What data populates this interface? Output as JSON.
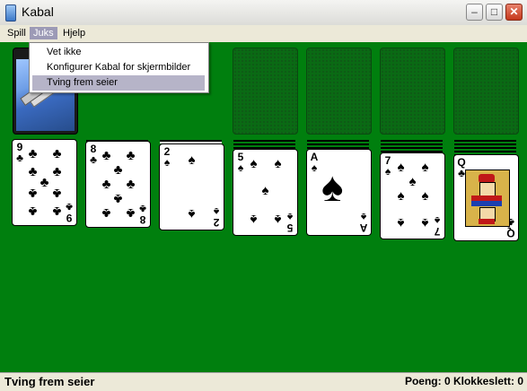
{
  "window": {
    "title": "Kabal",
    "minimize": "–",
    "maximize": "□",
    "close": "✕"
  },
  "menubar": {
    "items": [
      "Spill",
      "Juks",
      "Hjelp"
    ],
    "active": "Juks"
  },
  "dropdown": {
    "items": [
      "Vet ikke",
      "Konfigurer Kabal for skjermbilder",
      "Tving frem seier"
    ],
    "highlighted": "Tving frem seier"
  },
  "statusbar": {
    "left": "Tving frem seier",
    "right": "Poeng: 0 Klokkeslett: 0"
  },
  "colors": {
    "table": "#007f0e",
    "menu_highlight": "#9c9ab6"
  },
  "tableau": [
    {
      "rank": "9",
      "suit": "♣"
    },
    {
      "rank": "8",
      "suit": "♣"
    },
    {
      "rank": "2",
      "suit": "♠"
    },
    {
      "rank": "5",
      "suit": "♠"
    },
    {
      "rank": "A",
      "suit": "♠"
    },
    {
      "rank": "7",
      "suit": "♠"
    },
    {
      "rank": "Q",
      "suit": "♣"
    }
  ],
  "foundations": {
    "count": 4
  },
  "stock": {
    "card_back": "space-shuttle"
  }
}
